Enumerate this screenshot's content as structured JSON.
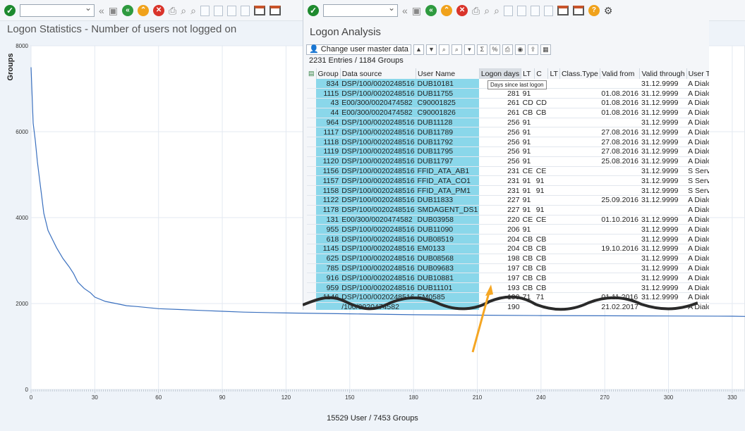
{
  "background_window": {
    "title": "Logon Statistics - Number of users not logged on",
    "footer": "15529 User  /  7453 Groups"
  },
  "dialog": {
    "title": "Logon Analysis",
    "change_button": "Change user master data",
    "entries_text": "2231  Entries    /    1184  Groups",
    "tooltip": "Days since last logon",
    "columns": [
      "Group",
      "Data source",
      "User Name",
      "Logon days",
      "LT",
      "C",
      "LT",
      "Class.Type",
      "Valid from",
      "Valid through",
      "User Type"
    ],
    "rows": [
      [
        "834",
        "DSP/100/0020248516",
        "DUB10181",
        ".",
        "",
        "",
        "",
        "",
        "",
        "31.12.9999",
        "A Dialog"
      ],
      [
        "1115",
        "DSP/100/0020248516",
        "DUB11755",
        "281",
        "91",
        "",
        "",
        "",
        "01.08.2016",
        "31.12.9999",
        "A Dialog"
      ],
      [
        "43",
        "E00/300/0020474582",
        "C90001825",
        "261",
        "CD",
        "CD",
        "",
        "",
        "01.08.2016",
        "31.12.9999",
        "A Dialog"
      ],
      [
        "44",
        "E00/300/0020474582",
        "C90001826",
        "261",
        "CB",
        "CB",
        "",
        "",
        "01.08.2016",
        "31.12.9999",
        "A Dialog"
      ],
      [
        "964",
        "DSP/100/0020248516",
        "DUB11128",
        "256",
        "91",
        "",
        "",
        "",
        "",
        "31.12.9999",
        "A Dialog"
      ],
      [
        "1117",
        "DSP/100/0020248516",
        "DUB11789",
        "256",
        "91",
        "",
        "",
        "",
        "27.08.2016",
        "31.12.9999",
        "A Dialog"
      ],
      [
        "1118",
        "DSP/100/0020248516",
        "DUB11792",
        "256",
        "91",
        "",
        "",
        "",
        "27.08.2016",
        "31.12.9999",
        "A Dialog"
      ],
      [
        "1119",
        "DSP/100/0020248516",
        "DUB11795",
        "256",
        "91",
        "",
        "",
        "",
        "27.08.2016",
        "31.12.9999",
        "A Dialog"
      ],
      [
        "1120",
        "DSP/100/0020248516",
        "DUB11797",
        "256",
        "91",
        "",
        "",
        "",
        "25.08.2016",
        "31.12.9999",
        "A Dialog"
      ],
      [
        "1156",
        "DSP/100/0020248516",
        "FFID_ATA_AB1",
        "231",
        "CE",
        "CE",
        "",
        "",
        "",
        "31.12.9999",
        "S Service"
      ],
      [
        "1157",
        "DSP/100/0020248516",
        "FFID_ATA_CO1",
        "231",
        "91",
        "91",
        "",
        "",
        "",
        "31.12.9999",
        "S Service"
      ],
      [
        "1158",
        "DSP/100/0020248516",
        "FFID_ATA_PM1",
        "231",
        "91",
        "91",
        "",
        "",
        "",
        "31.12.9999",
        "S Service"
      ],
      [
        "1122",
        "DSP/100/0020248516",
        "DUB11833",
        "227",
        "91",
        "",
        "",
        "",
        "25.09.2016",
        "31.12.9999",
        "A Dialog"
      ],
      [
        "1178",
        "DSP/100/0020248516",
        "SMDAGENT_DS1",
        "227",
        "91",
        "91",
        "",
        "",
        "",
        "",
        "A Dialog"
      ],
      [
        "131",
        "E00/300/0020474582",
        "DUB03958",
        "220",
        "CE",
        "CE",
        "",
        "",
        "01.10.2016",
        "31.12.9999",
        "A Dialog"
      ],
      [
        "955",
        "DSP/100/0020248516",
        "DUB11090",
        "206",
        "91",
        "",
        "",
        "",
        "",
        "31.12.9999",
        "A Dialog"
      ],
      [
        "618",
        "DSP/100/0020248516",
        "DUB08519",
        "204",
        "CB",
        "CB",
        "",
        "",
        "",
        "31.12.9999",
        "A Dialog"
      ],
      [
        "1145",
        "DSP/100/0020248516",
        "EM0133",
        "204",
        "CB",
        "CB",
        "",
        "",
        "19.10.2016",
        "31.12.9999",
        "A Dialog"
      ],
      [
        "625",
        "DSP/100/0020248516",
        "DUB08568",
        "198",
        "CB",
        "CB",
        "",
        "",
        "",
        "31.12.9999",
        "A Dialog"
      ],
      [
        "785",
        "DSP/100/0020248516",
        "DUB09683",
        "197",
        "CB",
        "CB",
        "",
        "",
        "",
        "31.12.9999",
        "A Dialog"
      ],
      [
        "916",
        "DSP/100/0020248516",
        "DUB10881",
        "197",
        "CB",
        "CB",
        "",
        "",
        "",
        "31.12.9999",
        "A Dialog"
      ],
      [
        "959",
        "DSP/100/0020248516",
        "DUB11101",
        "193",
        "CB",
        "CB",
        "",
        "",
        "",
        "31.12.9999",
        "A Dialog"
      ],
      [
        "1146",
        "DSP/100/0020248516",
        "EM0585",
        "190",
        "71",
        "71",
        "",
        "",
        "01.11.2016",
        "31.12.9999",
        "A Dialog"
      ],
      [
        "",
        "/100/0020474582",
        "",
        "190",
        "",
        "",
        "",
        "",
        "21.02.2017",
        "",
        "A Dialog"
      ]
    ]
  },
  "chart_data": {
    "type": "line",
    "ylabel": "Groups",
    "xlim": [
      0,
      336
    ],
    "ylim": [
      0,
      8000
    ],
    "x_ticks": [
      0,
      30,
      60,
      90,
      120,
      150,
      180,
      210,
      240,
      270,
      300,
      330
    ],
    "y_ticks": [
      0,
      2000,
      4000,
      6000,
      8000
    ],
    "grid": true,
    "series": [
      {
        "x": [
          0,
          1,
          2,
          3,
          4,
          5,
          6,
          8,
          10,
          12,
          15,
          18,
          20,
          22,
          25,
          28,
          30,
          35,
          40,
          45,
          50,
          60,
          70,
          80,
          90,
          100,
          120,
          150,
          180,
          210,
          240,
          270,
          300,
          330,
          336
        ],
        "values": [
          7500,
          6200,
          5800,
          5300,
          4900,
          4500,
          4100,
          3700,
          3500,
          3300,
          3050,
          2850,
          2700,
          2500,
          2350,
          2250,
          2150,
          2050,
          2000,
          1950,
          1930,
          1880,
          1860,
          1840,
          1820,
          1800,
          1780,
          1760,
          1740,
          1730,
          1720,
          1715,
          1710,
          1705,
          1700
        ]
      }
    ]
  },
  "colors": {
    "line": "#3a70bf",
    "selected_column": "#8ad7ea",
    "arrow": "#f5a623"
  }
}
